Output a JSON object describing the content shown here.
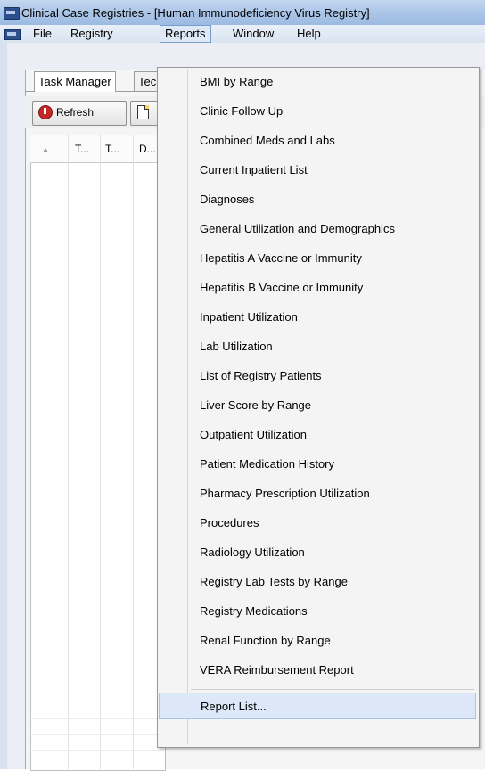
{
  "window": {
    "title": "Clinical Case Registries - [Human Immunodeficiency Virus Registry]"
  },
  "menubar": {
    "items": [
      "File",
      "Registry",
      "Reports",
      "Window",
      "Help"
    ]
  },
  "tabs": [
    "Task Manager",
    "Tec"
  ],
  "toolbar": {
    "refresh_label": "Refresh"
  },
  "grid": {
    "columns": [
      "T...",
      "T...",
      "D..."
    ]
  },
  "reports_menu": {
    "items": [
      "BMI by Range",
      "Clinic Follow Up",
      "Combined Meds and Labs",
      "Current Inpatient List",
      "Diagnoses",
      "General Utilization and Demographics",
      "Hepatitis A Vaccine or Immunity",
      "Hepatitis B Vaccine or Immunity",
      "Inpatient Utilization",
      "Lab Utilization",
      "List of Registry Patients",
      "Liver Score by Range",
      "Outpatient Utilization",
      "Patient Medication History",
      "Pharmacy Prescription Utilization",
      "Procedures",
      "Radiology Utilization",
      "Registry Lab Tests by Range",
      "Registry Medications",
      "Renal Function by Range",
      "VERA Reimbursement Report"
    ],
    "footer_item": "Report List..."
  }
}
